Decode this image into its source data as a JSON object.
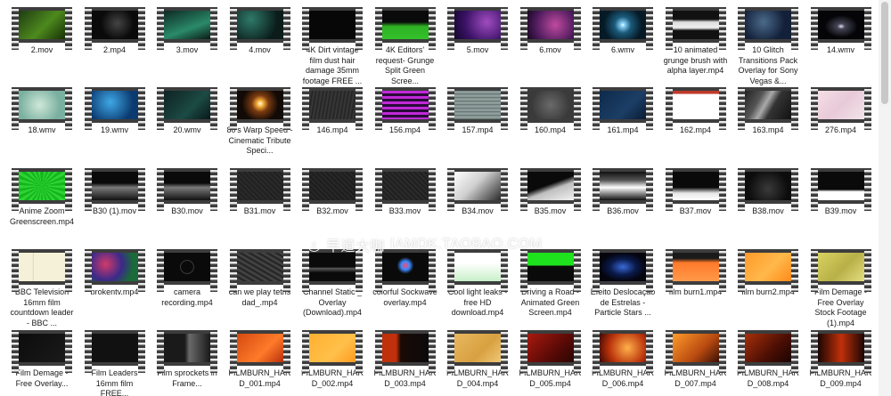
{
  "watermark": {
    "cjk": "早道大咖",
    "latin": "IAMDK.TAOBAO.COM"
  },
  "files": [
    {
      "name": "2.mov",
      "thumb": "linear-gradient(135deg,#1f3b12,#4d8a1d 55%,#173006)"
    },
    {
      "name": "2.mp4",
      "thumb": "radial-gradient(circle at 55% 45%,#444 0,#0a0a0a 55%)"
    },
    {
      "name": "3.mov",
      "thumb": "linear-gradient(160deg,#0d2a22,#2a8a6a 60%,#0a1a14)"
    },
    {
      "name": "4.mov",
      "thumb": "radial-gradient(circle at 30% 30%,#2e7a6a,#0b1c1a 70%)"
    },
    {
      "name": "4K Dirt vintage film dust hair damage 35mm footage FREE ...",
      "thumb": "#070707"
    },
    {
      "name": "4K Editors' request- Grunge Split Green Scree...",
      "thumb": "linear-gradient(to bottom,#0a0a0a 0,#0a0a0a 40%,#2fb024 55%,#33c22a 100%)"
    },
    {
      "name": "5.mov",
      "thumb": "radial-gradient(circle at 70% 40%,#a04cc0,#3a1266 60%,#14062a)"
    },
    {
      "name": "6.mov",
      "thumb": "radial-gradient(circle at 60% 50%,#c04aa0,#4a1a5a 65%,#1a0820)"
    },
    {
      "name": "6.wmv",
      "thumb": "radial-gradient(circle at 50% 50%,#ffffff 0,#8fd8ff 6%,#1b5a7a 30%,#061a26 70%)"
    },
    {
      "name": "10 animated grunge brush with alpha layer.mp4",
      "thumb": "linear-gradient(to bottom,#111 0,#111 30%,#ddd 40%,#eee 60%,#111 70%)"
    },
    {
      "name": "10 Glitch Transitions Pack Overlay for Sony Vegas &...",
      "thumb": "radial-gradient(circle at 40% 40%,#4a6a8a,#13203a 65%)"
    },
    {
      "name": "14.wmv",
      "thumb": "radial-gradient(ellipse at 50% 55%,#dde 0,#445 12%,#050508 50%)"
    },
    {
      "name": "18.wmv",
      "thumb": "radial-gradient(circle at 45% 50%,#cfe8d8,#7ab0a0 70%)"
    },
    {
      "name": "19.wmv",
      "thumb": "radial-gradient(circle at 40% 40%,#3fa8e6,#0b3a70 70%)"
    },
    {
      "name": "20.wmv",
      "thumb": "linear-gradient(135deg,#0e2222,#1c4a44 60%,#081818)"
    },
    {
      "name": "80's Warp Speed - Cinematic Tribute Speci...",
      "thumb": "radial-gradient(circle at 50% 45%,#fff 0,#ffb840 10%,#7a3a10 30%,#120a06 65%)"
    },
    {
      "name": "146.mp4",
      "thumb": "repeating-linear-gradient(100deg,#2a2a2a 0,#3a3a3a 2px,#1e1e1e 4px)"
    },
    {
      "name": "156.mp4",
      "thumb": "repeating-linear-gradient(to bottom,#c029d8 0,#c029d8 3px,#2a0a3a 3px,#2a0a3a 6px)"
    },
    {
      "name": "157.mp4",
      "thumb": "repeating-linear-gradient(to bottom,#7a8a8a 0,#9aa8a4 2px,#5a6a6a 4px)"
    },
    {
      "name": "160.mp4",
      "thumb": "radial-gradient(circle at 50% 50%,#6a6a6a,#3a3a3a 70%)"
    },
    {
      "name": "161.mp4",
      "thumb": "linear-gradient(135deg,#0e2a4a,#1c3e66 60%,#0a1c33)"
    },
    {
      "name": "162.mp4",
      "thumb": "linear-gradient(to bottom,#c0392b 0,#c0392b 10%,#ffffff 12%,#ffffff 100%)"
    },
    {
      "name": "163.mp4",
      "thumb": "linear-gradient(120deg,#222 0,#555 30%,#aaa 45%,#333 60%,#111)"
    },
    {
      "name": "276.mp4",
      "thumb": "linear-gradient(135deg,#f4dfe6,#e8c9d8 50%,#f2e4ea)"
    },
    {
      "name": "Anime Zoom Greenscreen.mp4",
      "thumb": "repeating-conic-gradient(from 0deg at 50% 50%,#13b71a 0deg 8deg,#2fd236 8deg 16deg)"
    },
    {
      "name": "B30 (1).mov",
      "thumb": "linear-gradient(to bottom,#0a0a0a 0,#0a0a0a 40%,#7a7a7a 55%,#111 100%)"
    },
    {
      "name": "B30.mov",
      "thumb": "linear-gradient(to bottom,#0a0a0a 0,#0a0a0a 40%,#7a7a7a 55%,#111 100%)"
    },
    {
      "name": "B31.mov",
      "thumb": "repeating-linear-gradient(45deg,#222 0,#2c2c2c 2px,#1c1c1c 4px)"
    },
    {
      "name": "B32.mov",
      "thumb": "repeating-linear-gradient(45deg,#1e1e1e 0,#2a2a2a 2px,#181818 4px)"
    },
    {
      "name": "B33.mov",
      "thumb": "repeating-linear-gradient(45deg,#202020 0,#2e2e2e 2px,#1a1a1a 4px)"
    },
    {
      "name": "B34.mov",
      "thumb": "linear-gradient(135deg,#ffffff,#cfcfcf 45%,#2a2a2a 100%)"
    },
    {
      "name": "B35.mov",
      "thumb": "linear-gradient(160deg,#0a0a0a 0,#0a0a0a 45%,#bfbfbf 60%,#f2f2f2 100%)"
    },
    {
      "name": "B36.mov",
      "thumb": "linear-gradient(to bottom,#111 0,#555 30%,#ffffff 55%,#777 80%,#111)"
    },
    {
      "name": "B37.mov",
      "thumb": "linear-gradient(to bottom,#0a0a0a 0,#0a0a0a 55%,#e6e6e6 75%,#ffffff 100%)"
    },
    {
      "name": "B38.mov",
      "thumb": "radial-gradient(circle at 50% 60%,#3a3a3a,#0c0c0c 70%)"
    },
    {
      "name": "B39.mov",
      "thumb": "linear-gradient(to bottom,#0a0a0a 0,#0a0a0a 62%,#ffffff 70%,#ffffff 100%)"
    },
    {
      "name": "BBC Television 16mm film countdown leader - BBC ...",
      "thumb": "linear-gradient(to right,#f5f1d8 0,#f5f1d8 30%,#d8d2a8 31%,#f5f1d8 33%,#f5f1d8 100%)"
    },
    {
      "name": "brokentv.mp4",
      "thumb": "radial-gradient(circle at 30% 40%,#d23a6a,#3a2a8a 45%,#1a6a3a 75%)"
    },
    {
      "name": "camera recording.mp4",
      "thumb": "radial-gradient(circle at 50% 50%,#0a0a0a 0,#0a0a0a 22%,#4a4a4a 24%,#0a0a0a 27%,#0a0a0a 100%)"
    },
    {
      "name": "can we play tetris dad_.mp4",
      "thumb": "repeating-linear-gradient(30deg,#2a2a2a 0,#4a4a4a 2px,#1a1a1a 5px)"
    },
    {
      "name": "Channel Static _ Overlay (Download).mp4",
      "thumb": "linear-gradient(to bottom,#0a0a0a 0,#0a0a0a 50%,#5a5a5a 55%,#0a0a0a 70%)"
    },
    {
      "name": "colorful Sockwave overlay.mp4",
      "thumb": "radial-gradient(circle at 50% 45%,#ff4a6a 0,#3a8aff 15%,#0a0a0a 30%)"
    },
    {
      "name": "Cool light leaks - free HD download.mp4",
      "thumb": "linear-gradient(to bottom,#ffffff 0,#ffffff 35%,#c8f0c8 100%)"
    },
    {
      "name": "Driving a Road - Animated Green Screen.mp4",
      "thumb": "linear-gradient(to bottom,#1ee21e 0,#1ee21e 45%,#0a0a0a 46%,#0a0a0a 100%)"
    },
    {
      "name": "Efeito Deslocação de Estrelas - Particle Stars ...",
      "thumb": "radial-gradient(ellipse at 50% 50%,#3a6ad8 0,#0a1a4a 40%,#050510 70%)"
    },
    {
      "name": "film burn1.mp4",
      "thumb": "linear-gradient(to bottom,#1a1a1a 0,#1a1a1a 20%,#ff7a2a 35%,#ff9a4a 100%)"
    },
    {
      "name": "film burn2.mp4",
      "thumb": "linear-gradient(135deg,#ff9a2a,#ffb84a 55%,#ff8a1a)"
    },
    {
      "name": "Film Demage - Free Overlay Stock Footage (1).mp4",
      "thumb": "linear-gradient(135deg,#d8d260,#b8b048 55%,#e4de80)"
    },
    {
      "name": "Film Demage - Free Overlay...",
      "thumb": "linear-gradient(135deg,#0c0c0c,#1a1a1a)"
    },
    {
      "name": "Film Leaders 16mm film FREE...",
      "thumb": "linear-gradient(to bottom,#111 0,#111 100%)"
    },
    {
      "name": "Film sprockets in Frame...",
      "thumb": "linear-gradient(to right,#1a1a1a 0,#1a1a1a 45%,#6a6a6a 55%,#1a1a1a 100%)"
    },
    {
      "name": "FILMBURN_HARD_001.mp4",
      "thumb": "linear-gradient(135deg,#d44a10,#ff7a2a 60%,#b8300a)"
    },
    {
      "name": "FILMBURN_HARD_002.mp4",
      "thumb": "linear-gradient(135deg,#ffb030,#ffc04a 60%,#ff9a20)"
    },
    {
      "name": "FILMBURN_HARD_003.mp4",
      "thumb": "linear-gradient(to right,#c0300a 0,#c0300a 30%,#1a0a06 40%,#0a0a0a 100%)"
    },
    {
      "name": "FILMBURN_HARD_004.mp4",
      "thumb": "linear-gradient(135deg,#e8b860,#d8a040 60%,#f0c878)"
    },
    {
      "name": "FILMBURN_HARD_005.mp4",
      "thumb": "linear-gradient(135deg,#a81a10,#5a0a06 60%,#2a0603)"
    },
    {
      "name": "FILMBURN_HARD_006.mp4",
      "thumb": "radial-gradient(circle at 60% 50%,#ffb04a,#b8300a 60%,#3a0a04)"
    },
    {
      "name": "FILMBURN_HARD_007.mp4",
      "thumb": "linear-gradient(135deg,#ff9a2a,#b84a10 60%,#3a1004)"
    },
    {
      "name": "FILMBURN_HARD_008.mp4",
      "thumb": "linear-gradient(135deg,#a8300a,#4a0e04 60%,#1a0402)"
    },
    {
      "name": "FILMBURN_HARD_009.mp4",
      "thumb": "linear-gradient(to right,#1a0603 0,#c0300a 50%,#1a0603 100%)"
    }
  ]
}
